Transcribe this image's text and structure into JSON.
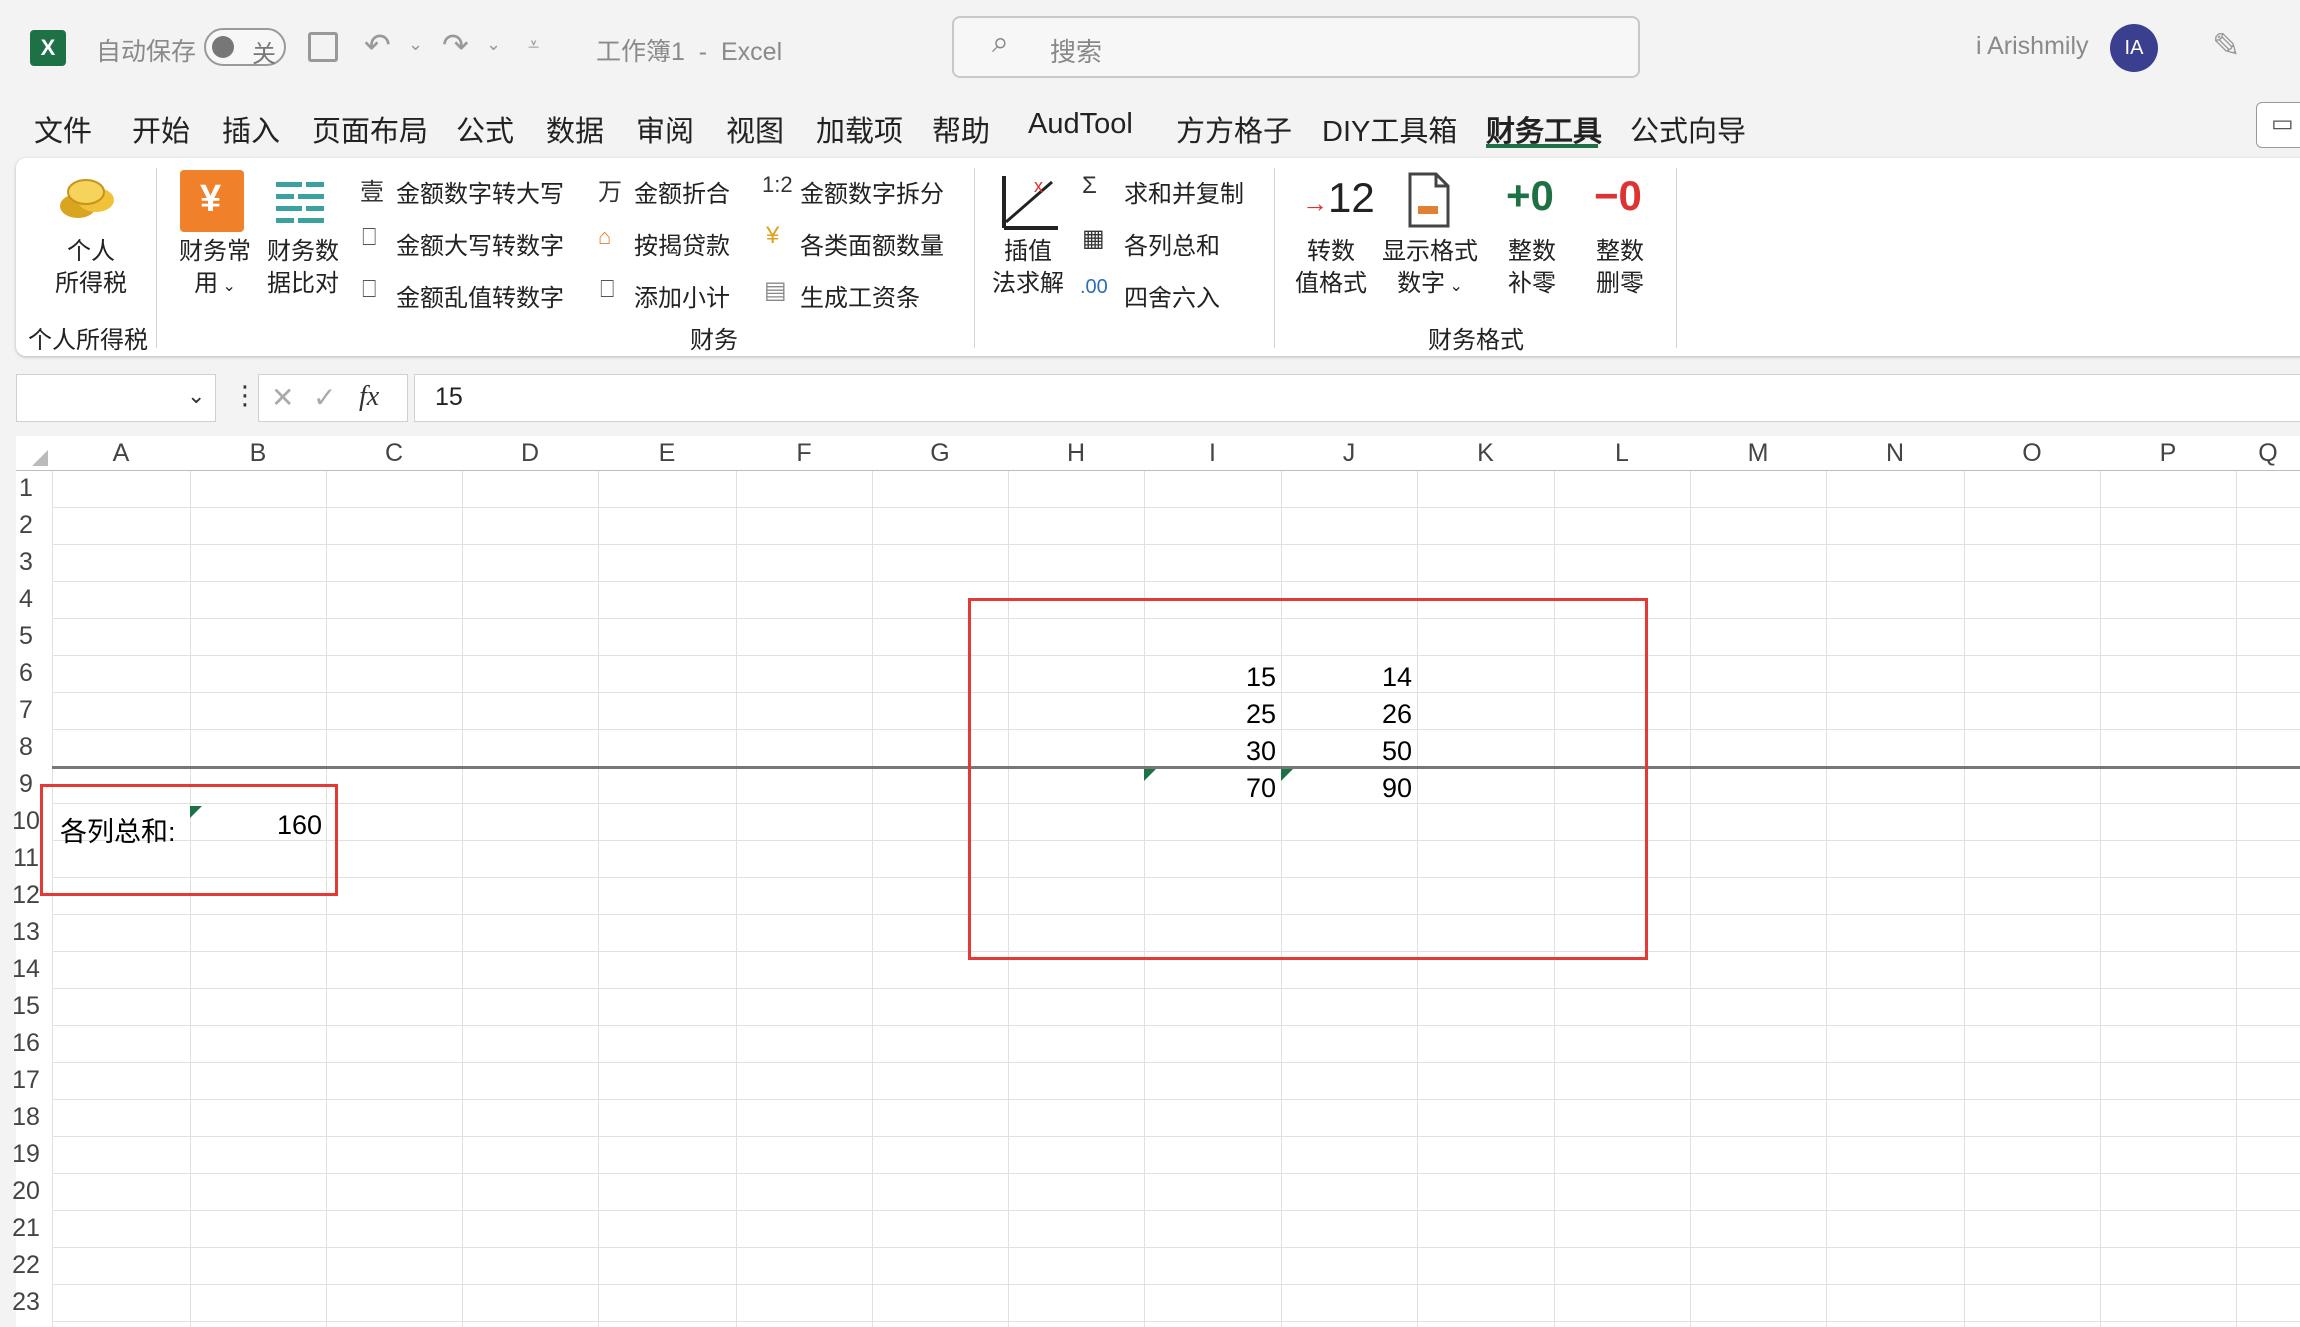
{
  "titlebar": {
    "autosave_label": "自动保存",
    "toggle_state": "关",
    "doc_title": "工作簿1  -  Excel",
    "search_placeholder": "搜索",
    "user_name": "i Arishmily",
    "user_initials": "IA"
  },
  "menu": [
    "文件",
    "开始",
    "插入",
    "页面布局",
    "公式",
    "数据",
    "审阅",
    "视图",
    "加载项",
    "帮助",
    "AudTool",
    "方方格子",
    "DIY工具箱",
    "财务工具",
    "公式向导"
  ],
  "menu_active": "财务工具",
  "ribbon": {
    "groups": {
      "tax": "个人所得税",
      "finance": "财务",
      "format": "财务格式"
    },
    "tax_btn": [
      "个人",
      "所得税"
    ],
    "fin_common": [
      "财务常",
      "用"
    ],
    "fin_compare": [
      "财务数",
      "据比对"
    ],
    "col1": [
      "金额数字转大写",
      "金额大写转数字",
      "金额乱值转数字"
    ],
    "col2": [
      "金额折合",
      "按揭贷款",
      "添加小计"
    ],
    "col3": [
      "金额数字拆分",
      "各类面额数量",
      "生成工资条"
    ],
    "interp": [
      "插值",
      "法求解"
    ],
    "col4": [
      "求和并复制",
      "各列总和",
      "四舍六入"
    ],
    "fmt_btns": [
      {
        "icon": "→12",
        "l1": "转数",
        "l2": "值格式"
      },
      {
        "icon": "",
        "l1": "显示格式",
        "l2": "数字"
      },
      {
        "icon": "+0",
        "l1": "整数",
        "l2": "补零"
      },
      {
        "icon": "−0",
        "l1": "整数",
        "l2": "删零"
      }
    ]
  },
  "formula_bar": {
    "fx": "fx",
    "value": "15"
  },
  "columns": [
    "A",
    "B",
    "C",
    "D",
    "E",
    "F",
    "G",
    "H",
    "I",
    "J",
    "K",
    "L",
    "M",
    "N",
    "O",
    "P",
    "Q"
  ],
  "rows": [
    "1",
    "2",
    "3",
    "4",
    "5",
    "6",
    "7",
    "8",
    "9",
    "10",
    "11",
    "12",
    "13",
    "14",
    "15",
    "16",
    "17",
    "18",
    "19",
    "20",
    "21",
    "22",
    "23"
  ],
  "cells": {
    "A10": "各列总和:",
    "B10": "160",
    "I6": "15",
    "J6": "14",
    "I7": "25",
    "J7": "26",
    "I8": "30",
    "J8": "50",
    "I9": "70",
    "J9": "90"
  },
  "colors": {
    "excel_green": "#1e7145",
    "highlight_red": "#e53935"
  }
}
